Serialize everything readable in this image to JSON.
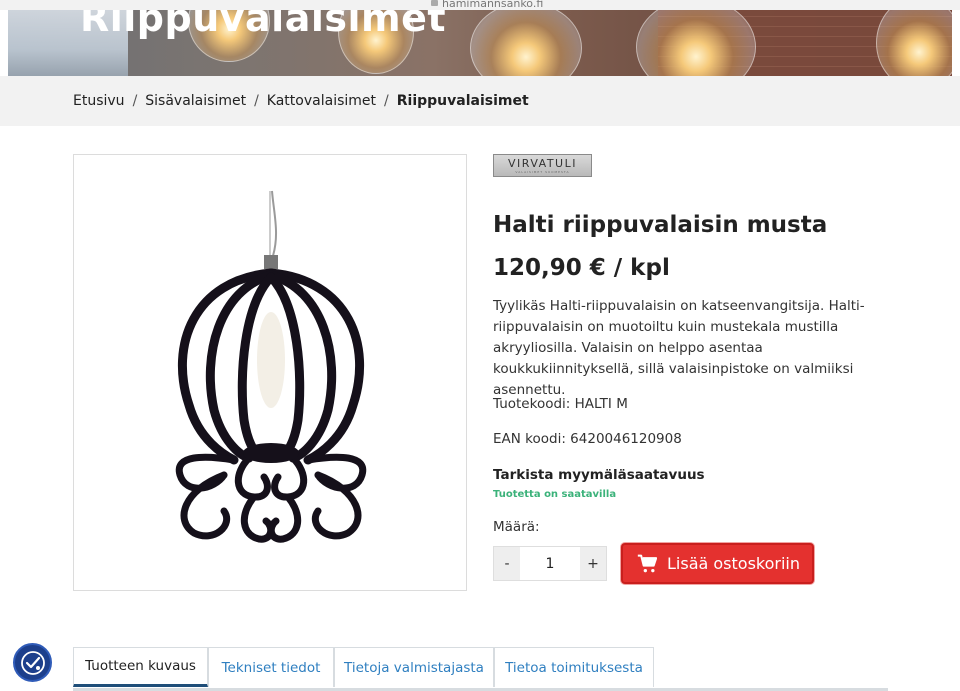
{
  "browser": {
    "url": "hamimannsanko.fi"
  },
  "hero": {
    "title": "Riippuvalaisimet"
  },
  "breadcrumb": {
    "items": [
      "Etusivu",
      "Sisävalaisimet",
      "Kattovalaisimet"
    ],
    "current": "Riippuvalaisimet",
    "separator": "/"
  },
  "brand": {
    "name": "VIRVATULI",
    "tagline": "VALAISIMET SUOMESTA"
  },
  "product": {
    "title": "Halti riippuvalaisin musta",
    "price": "120,90 € / kpl",
    "description": "Tyylikäs Halti-riippuvalaisin on katseenvangitsija. Halti-riippuvalaisin on muotoiltu kuin mustekala mustilla akryyliosilla. Valaisin on helppo asentaa koukkukiinnityksellä, sillä valaisinpistoke on valmiiksi asennettu.",
    "code": "Tuotekoodi: HALTI M",
    "ean": "EAN koodi: 6420046120908",
    "availability_title": "Tarkista myymäläsaatavuus",
    "availability_status": "Tuotetta on saatavilla",
    "quantity_label": "Määrä:",
    "quantity_value": "1",
    "decrement": "-",
    "increment": "+",
    "add_to_cart": "Lisää ostoskoriin"
  },
  "tabs": [
    {
      "label": "Tuotteen kuvaus",
      "active": true
    },
    {
      "label": "Tekniset tiedot",
      "active": false
    },
    {
      "label": "Tietoja valmistajasta",
      "active": false
    },
    {
      "label": "Tietoa toimituksesta",
      "active": false
    }
  ],
  "colors": {
    "accent_red": "#e4312f",
    "availability_green": "#3bb27a",
    "tab_link": "#2f7fc0",
    "a11y_badge": "#1c3f8c"
  },
  "icons": {
    "cart": "shopping-cart-icon",
    "accessibility": "accessibility-icon"
  }
}
